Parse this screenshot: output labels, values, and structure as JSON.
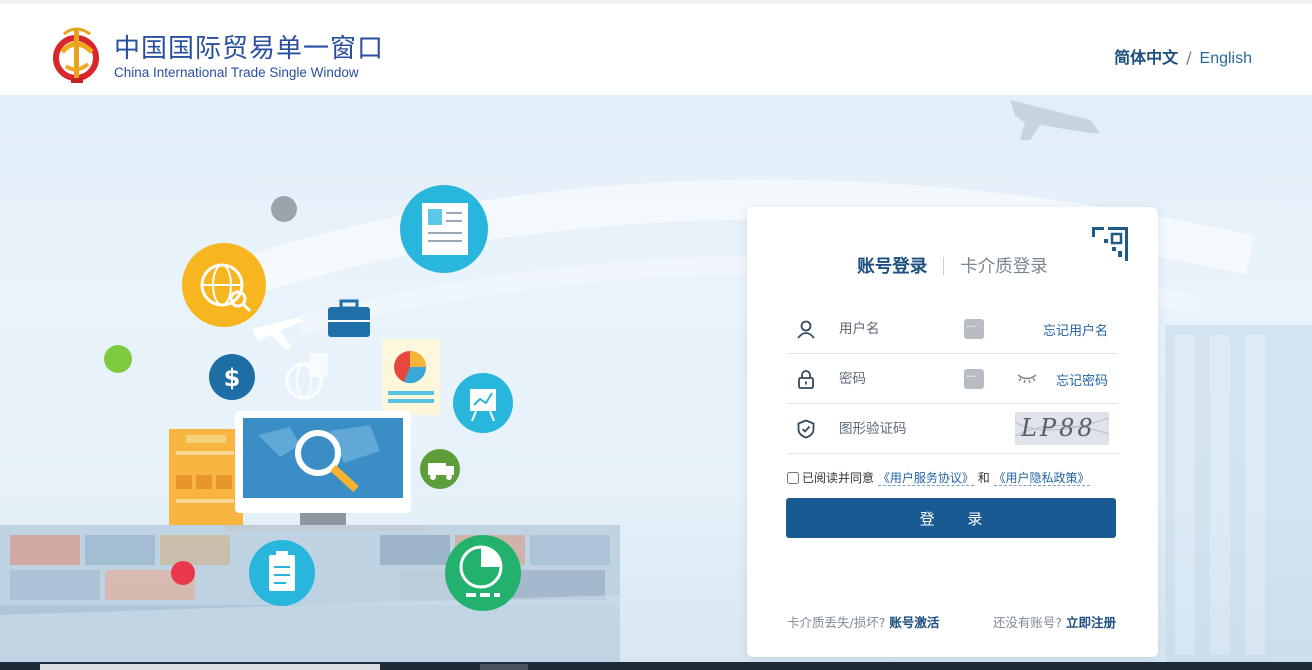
{
  "header": {
    "logo_cn": "中国国际贸易单一窗口",
    "logo_en": "China International Trade Single Window",
    "lang_cn": "简体中文",
    "lang_separator": "/",
    "lang_en": "English"
  },
  "login": {
    "tab_account": "账号登录",
    "tab_card": "卡介质登录",
    "username_placeholder": "用户名",
    "forgot_username": "忘记用户名",
    "password_placeholder": "密码",
    "forgot_password": "忘记密码",
    "captcha_placeholder": "图形验证码",
    "captcha_text": "LP88",
    "agree_prefix": "已阅读并同意",
    "service_agreement": "《用户服务协议》",
    "agree_and": "和",
    "privacy_policy": "《用户隐私政策》",
    "submit_label": "登 录",
    "card_lost_text": "卡介质丢失/损坏?",
    "activate_link": "账号激活",
    "no_account_text": "还没有账号?",
    "register_link": "立即注册"
  },
  "colors": {
    "brand_blue": "#1a5a93",
    "link_blue": "#2463a4",
    "logo_blue": "#2a4ea0"
  },
  "icons": [
    "user-icon",
    "lock-icon",
    "shield-check-icon",
    "keyboard-icon",
    "eye-closed-icon",
    "qr-code-icon"
  ]
}
